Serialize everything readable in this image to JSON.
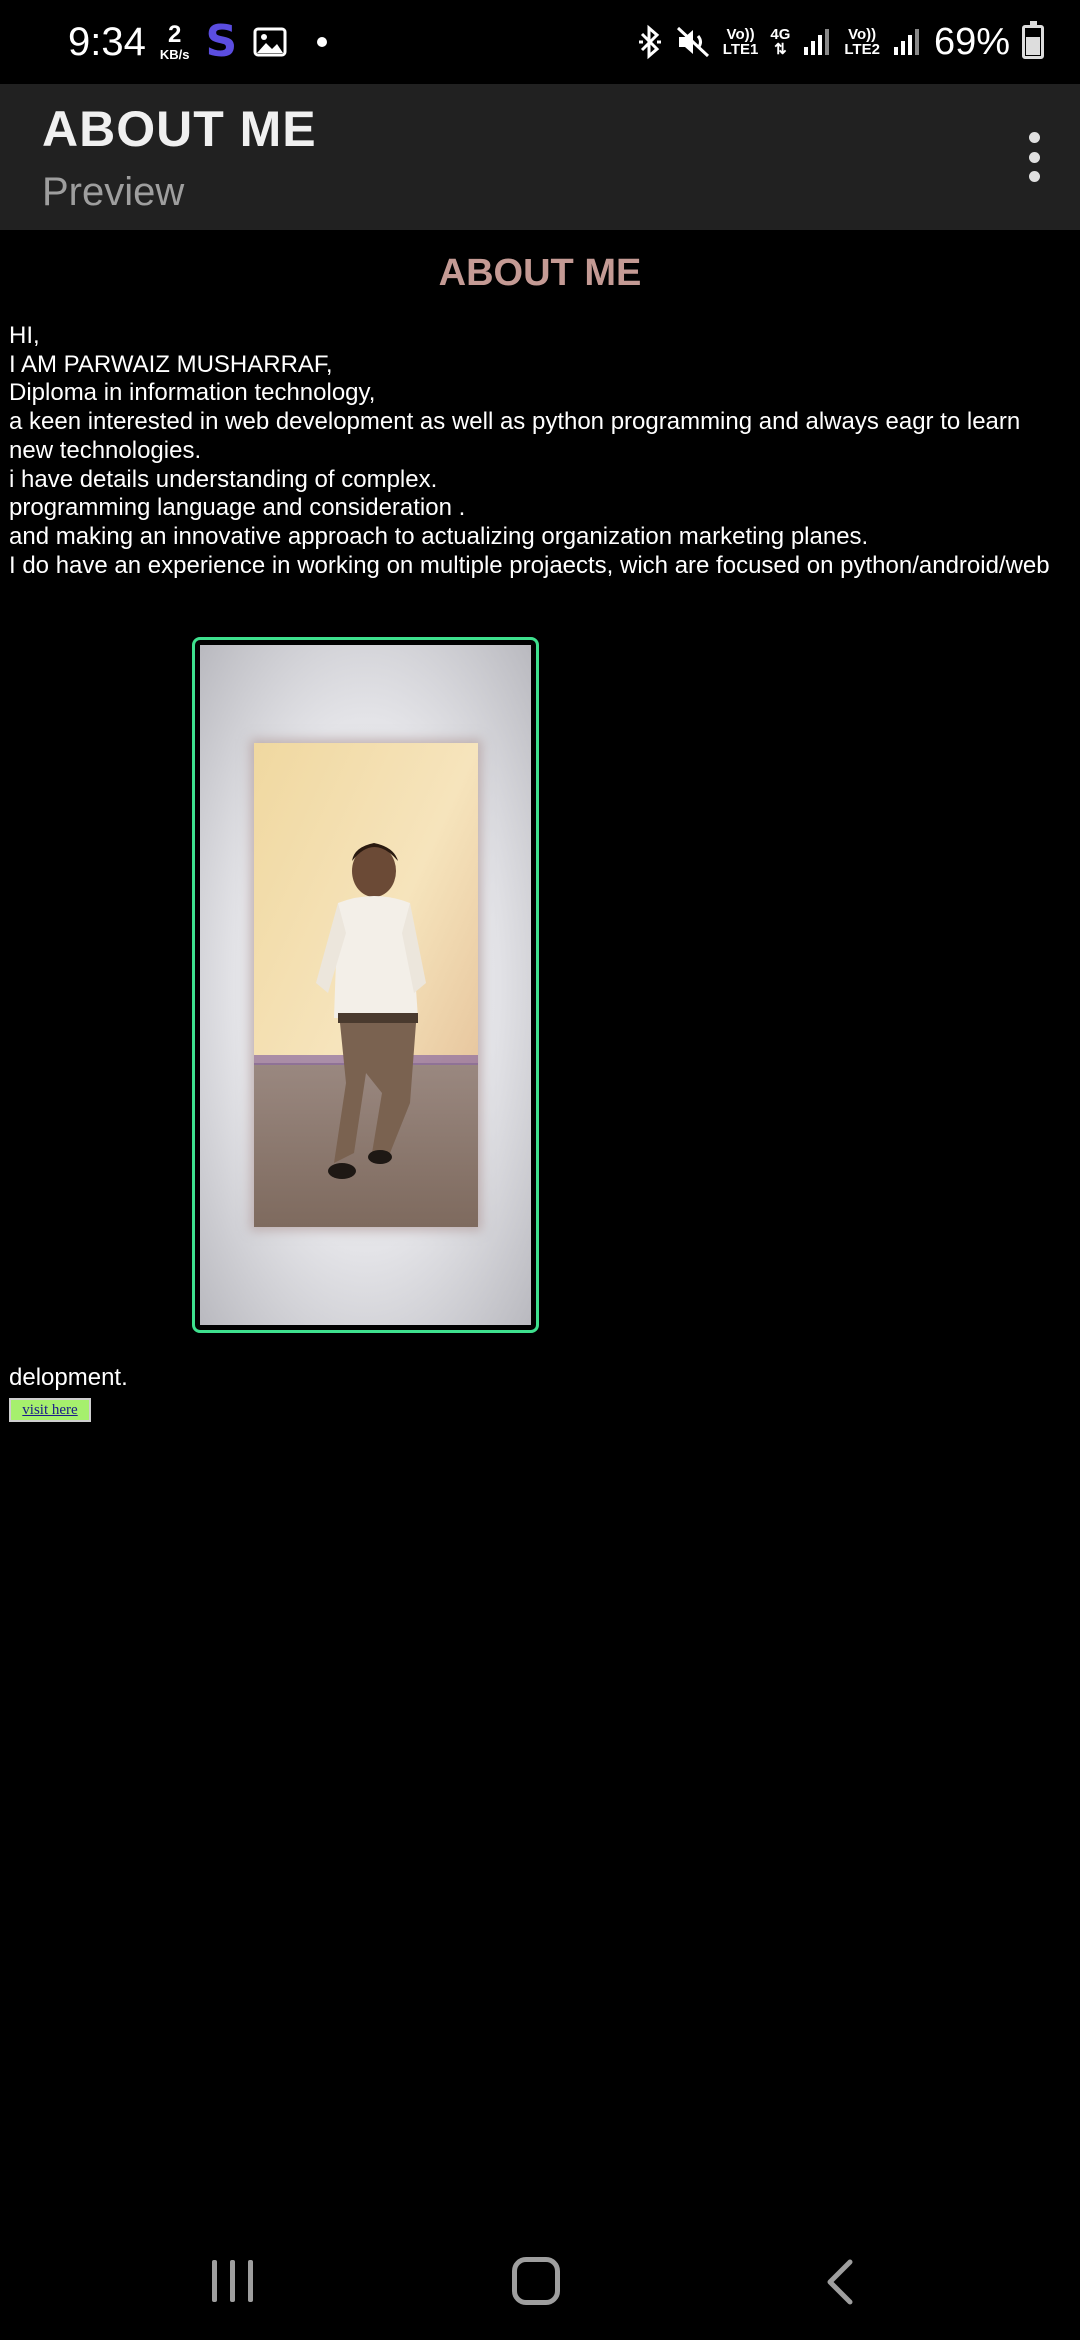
{
  "status_bar": {
    "time": "9:34",
    "net_speed_value": "2",
    "net_speed_unit": "KB/s",
    "s_app_letter": "S",
    "sim1_top": "Vo))",
    "sim1_bottom": "LTE1",
    "net_type": "4G",
    "sim2_top": "Vo))",
    "sim2_bottom": "LTE2",
    "battery": "69%"
  },
  "app_bar": {
    "title": "ABOUT ME",
    "subtitle": "Preview"
  },
  "page": {
    "heading": "ABOUT ME",
    "heading_color": "#c49a94",
    "lines": [
      "HI,",
      "I AM PARWAIZ MUSHARRAF,",
      "Diploma in information technology,",
      "a keen interested in web development as well as python programming and always eagr to learn",
      "new technologies.",
      "i have details understanding of complex.",
      "programming language and consideration .",
      "and making an innovative approach to actualizing organization marketing planes.",
      "I do have an experience in working on multiple projaects, wich are focused on python/android/web"
    ],
    "tail_text": "delopment.",
    "link_label": "visit here",
    "frame_color": "#3ee08e"
  },
  "icons": {
    "gallery": "gallery-icon",
    "bluetooth": "bluetooth-icon",
    "mute": "mute-icon",
    "signal": "signal-icon",
    "battery": "battery-icon",
    "overflow": "more-vert-icon",
    "recents": "recents-icon",
    "home": "home-icon",
    "back": "back-icon"
  }
}
